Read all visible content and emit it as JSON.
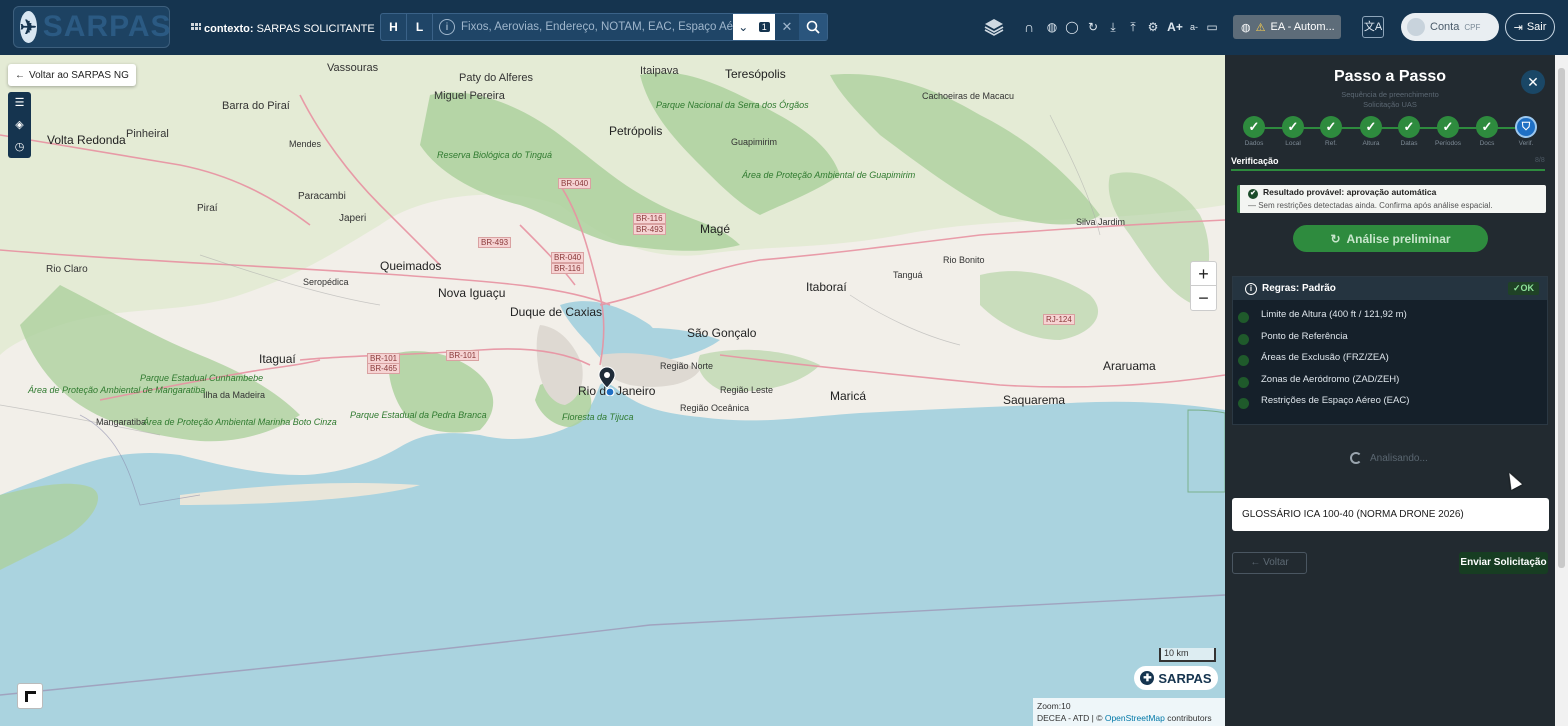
{
  "header": {
    "logo_text": "SARPAS",
    "context_label": "contexto:",
    "context_value": "SARPAS SOLICITANTE",
    "search": {
      "mode_h": "H",
      "mode_l": "L",
      "placeholder": "Fixos, Aerovias, Endereço, NOTAM, EAC, Espaço Aéreo (",
      "count": "1"
    },
    "env_label": "EA - Autom...",
    "account_label": "Conta",
    "account_sub": "CPF",
    "logout_label": "Sair"
  },
  "map": {
    "back_label": "Voltar ao SARPAS NG",
    "zoom_label": "Zoom:10",
    "attribution_prefix": "DECEA - ATD | ©",
    "attribution_link": "OpenStreetMap",
    "attribution_suffix": "contributors",
    "scale_label": "10 km",
    "brand": "SARPAS",
    "places": [
      "Vassouras",
      "Paty do Alferes",
      "Itaipava",
      "Teresópolis",
      "Barra do Piraí",
      "Miguel Pereira",
      "Volta Redonda",
      "Pinheiral",
      "Petrópolis",
      "Guapimirim",
      "Cachoeiras de Macacu",
      "Mendes",
      "Paracambi",
      "Japeri",
      "Piraí",
      "Magé",
      "Queimados",
      "Rio Claro",
      "Seropédica",
      "Nova Iguaçu",
      "Duque de Caxias",
      "Itaboraí",
      "Tanguá",
      "Rio Bonito",
      "Silva Jardim",
      "São Gonçalo",
      "Itaguaí",
      "Região Norte",
      "Região Leste",
      "Rio de Janeiro",
      "Região Oceânica",
      "Maricá",
      "Araruama",
      "Saquarema",
      "Ilha da Madeira",
      "Mangaratiba"
    ],
    "roads": [
      "BR-040",
      "BR-116",
      "BR-493",
      "BR-101",
      "BR-465",
      "RJ-124"
    ],
    "parks": [
      "Reserva Biológica do Tinguá",
      "Parque Nacional da Serra dos Órgãos",
      "Área de Proteção Ambiental de Guapimirim",
      "Área de Proteção Ambiental de Mangaratiba",
      "Parque Estadual Cunhambebe",
      "Área de Proteção Ambiental Marinha Boto Cinza",
      "Parque Estadual da Pedra Branca",
      "Floresta da Tijuca"
    ]
  },
  "panel": {
    "title": "Passo a Passo",
    "subtitle_1": "Sequência de preenchimento",
    "subtitle_2": "Solicitação UAS",
    "steps": [
      {
        "label": "Dados",
        "icon": "check"
      },
      {
        "label": "Local",
        "icon": "check"
      },
      {
        "label": "Ref.",
        "icon": "check"
      },
      {
        "label": "Altura",
        "icon": "check"
      },
      {
        "label": "Datas",
        "icon": "check"
      },
      {
        "label": "Períodos",
        "icon": "check"
      },
      {
        "label": "Docs",
        "icon": "check"
      },
      {
        "label": "Verif.",
        "icon": "shield"
      }
    ],
    "section_label": "Verificação",
    "section_count": "8/8",
    "result_title": "Resultado provável: aprovação automática",
    "result_sub": "— Sem restrições detectadas ainda. Confirma após análise espacial.",
    "analyze_label": "Análise preliminar",
    "rules_title": "Regras: Padrão",
    "rules_status": "✓OK",
    "rules": [
      "Limite de Altura (400 ft / 121,92 m)",
      "Ponto de Referência",
      "Áreas de Exclusão (FRZ/ZEA)",
      "Zonas de Aeródromo (ZAD/ZEH)",
      "Restrições de Espaço Aéreo (EAC)"
    ],
    "loading_label": "Analisando...",
    "glossary_label": "GLOSSÁRIO ICA 100-40 (NORMA DRONE 2026)",
    "back_label": "← Voltar",
    "send_label": "Enviar Solicitação"
  },
  "colors": {
    "header_bg": "#15344f",
    "panel_bg": "#222a30",
    "success": "#2e8b3e",
    "sea": "#aad3df",
    "land": "#f2efe9"
  }
}
